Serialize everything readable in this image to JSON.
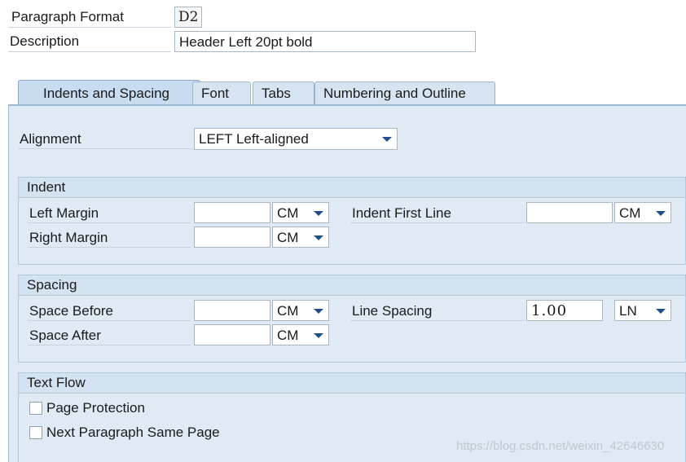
{
  "header": {
    "paragraph_format_label": "Paragraph Format",
    "paragraph_format_value": "D2",
    "description_label": "Description",
    "description_value": "Header Left 20pt bold"
  },
  "tabs": [
    {
      "label": "Indents and Spacing",
      "active": true
    },
    {
      "label": "Font",
      "active": false
    },
    {
      "label": "Tabs",
      "active": false
    },
    {
      "label": "Numbering and Outline",
      "active": false
    }
  ],
  "alignment": {
    "label": "Alignment",
    "value": "LEFT Left-aligned"
  },
  "indent": {
    "title": "Indent",
    "left_margin_label": "Left Margin",
    "left_margin_value": "",
    "left_margin_unit": "CM",
    "right_margin_label": "Right Margin",
    "right_margin_value": "",
    "right_margin_unit": "CM",
    "first_line_label": "Indent First Line",
    "first_line_value": "",
    "first_line_unit": "CM"
  },
  "spacing": {
    "title": "Spacing",
    "before_label": "Space Before",
    "before_value": "",
    "before_unit": "CM",
    "after_label": "Space After",
    "after_value": "",
    "after_unit": "CM",
    "line_label": "Line Spacing",
    "line_value": "1.00",
    "line_unit": "LN"
  },
  "text_flow": {
    "title": "Text Flow",
    "page_protection_label": "Page Protection",
    "next_paragraph_label": "Next Paragraph Same Page"
  },
  "watermark": "https://blog.csdn.net/weixin_42646630",
  "colors": {
    "panel_bg": "#dfeaf5",
    "tab_active": "#c7dcf0",
    "caret": "#1f4e8a"
  }
}
